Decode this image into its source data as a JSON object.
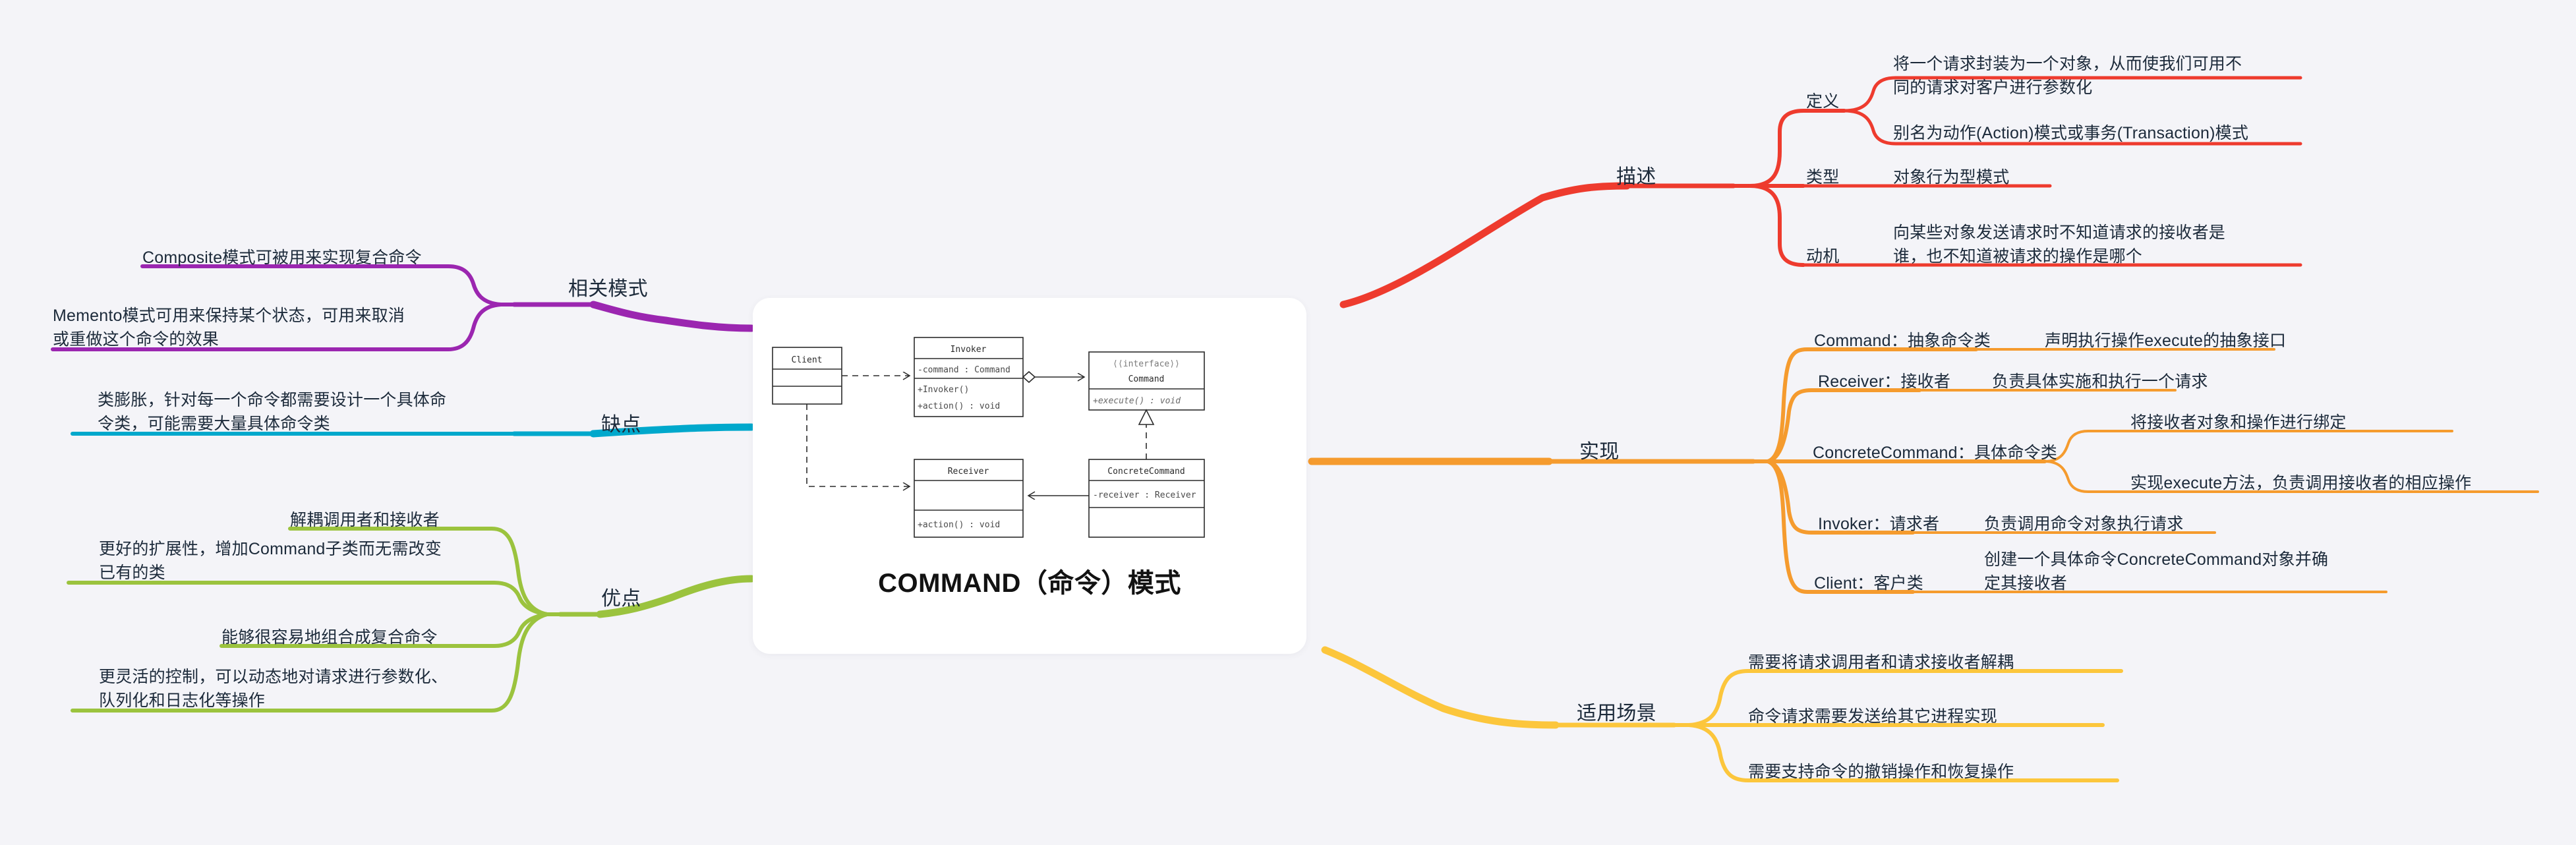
{
  "center": {
    "title": "COMMAND（命令）模式",
    "uml": {
      "classes": [
        {
          "id": "client",
          "name": "Client",
          "stereotype": "",
          "attributes": [],
          "operations": []
        },
        {
          "id": "invoker",
          "name": "Invoker",
          "stereotype": "",
          "attributes": [
            "-command : Command"
          ],
          "operations": [
            "+Invoker()",
            "+action() : void"
          ]
        },
        {
          "id": "command",
          "name": "Command",
          "stereotype": "《interface》",
          "attributes": [],
          "operations": [
            "+execute() : void"
          ]
        },
        {
          "id": "receiver",
          "name": "Receiver",
          "stereotype": "",
          "attributes": [],
          "operations": [
            "+action() : void"
          ]
        },
        {
          "id": "concretecommand",
          "name": "ConcreteCommand",
          "stereotype": "",
          "attributes": [
            "-receiver : Receiver"
          ],
          "operations": []
        }
      ],
      "relations": [
        {
          "from": "client",
          "to": "invoker",
          "type": "dependency"
        },
        {
          "from": "client",
          "to": "receiver",
          "type": "dependency"
        },
        {
          "from": "invoker",
          "to": "command",
          "type": "aggregation"
        },
        {
          "from": "concretecommand",
          "to": "command",
          "type": "realization"
        },
        {
          "from": "concretecommand",
          "to": "receiver",
          "type": "association"
        }
      ]
    }
  },
  "branches": {
    "description": {
      "label": "描述",
      "color": "#ee3b2e",
      "children": [
        {
          "label": "定义",
          "children": [
            {
              "label": "将一个请求封装为一个对象，从而使我们可用不\n同的请求对客户进行参数化"
            },
            {
              "label": "别名为动作(Action)模式或事务(Transaction)模式"
            }
          ]
        },
        {
          "label": "类型",
          "children": [
            {
              "label": "对象行为型模式"
            }
          ]
        },
        {
          "label": "动机",
          "children": [
            {
              "label": "向某些对象发送请求时不知道请求的接收者是\n谁，也不知道被请求的操作是哪个"
            }
          ]
        }
      ]
    },
    "implementation": {
      "label": "实现",
      "color": "#f59b2e",
      "children": [
        {
          "label": "Command：抽象命令类",
          "children": [
            {
              "label": "声明执行操作execute的抽象接口"
            }
          ]
        },
        {
          "label": "Receiver：接收者",
          "children": [
            {
              "label": "负责具体实施和执行一个请求"
            }
          ]
        },
        {
          "label": "ConcreteCommand：具体命令类",
          "children": [
            {
              "label": "将接收者对象和操作进行绑定"
            },
            {
              "label": "实现execute方法，负责调用接收者的相应操作"
            }
          ]
        },
        {
          "label": "Invoker：请求者",
          "children": [
            {
              "label": "负责调用命令对象执行请求"
            }
          ]
        },
        {
          "label": "Client：客户类",
          "children": [
            {
              "label": "创建一个具体命令ConcreteCommand对象并确\n定其接收者"
            }
          ]
        }
      ]
    },
    "scenarios": {
      "label": "适用场景",
      "color": "#fcc63c",
      "children": [
        {
          "label": "需要将请求调用者和请求接收者解耦"
        },
        {
          "label": "命令请求需要发送给其它进程实现"
        },
        {
          "label": "需要支持命令的撤销操作和恢复操作"
        }
      ]
    },
    "related_patterns": {
      "label": "相关模式",
      "color": "#9b26b0",
      "children": [
        {
          "label": "Composite模式可被用来实现复合命令"
        },
        {
          "label": "Memento模式可用来保持某个状态，可用来取消\n或重做这个命令的效果"
        }
      ]
    },
    "disadvantages": {
      "label": "缺点",
      "color": "#00a8cc",
      "children": [
        {
          "label": "类膨胀，针对每一个命令都需要设计一个具体命\n令类，可能需要大量具体命令类"
        }
      ]
    },
    "advantages": {
      "label": "优点",
      "color": "#9bc33e",
      "children": [
        {
          "label": "解耦调用者和接收者"
        },
        {
          "label": "更好的扩展性，增加Command子类而无需改变\n已有的类"
        },
        {
          "label": "能够很容易地组合成复合命令"
        },
        {
          "label": "更灵活的控制，可以动态地对请求进行参数化、\n队列化和日志化等操作"
        }
      ]
    }
  }
}
